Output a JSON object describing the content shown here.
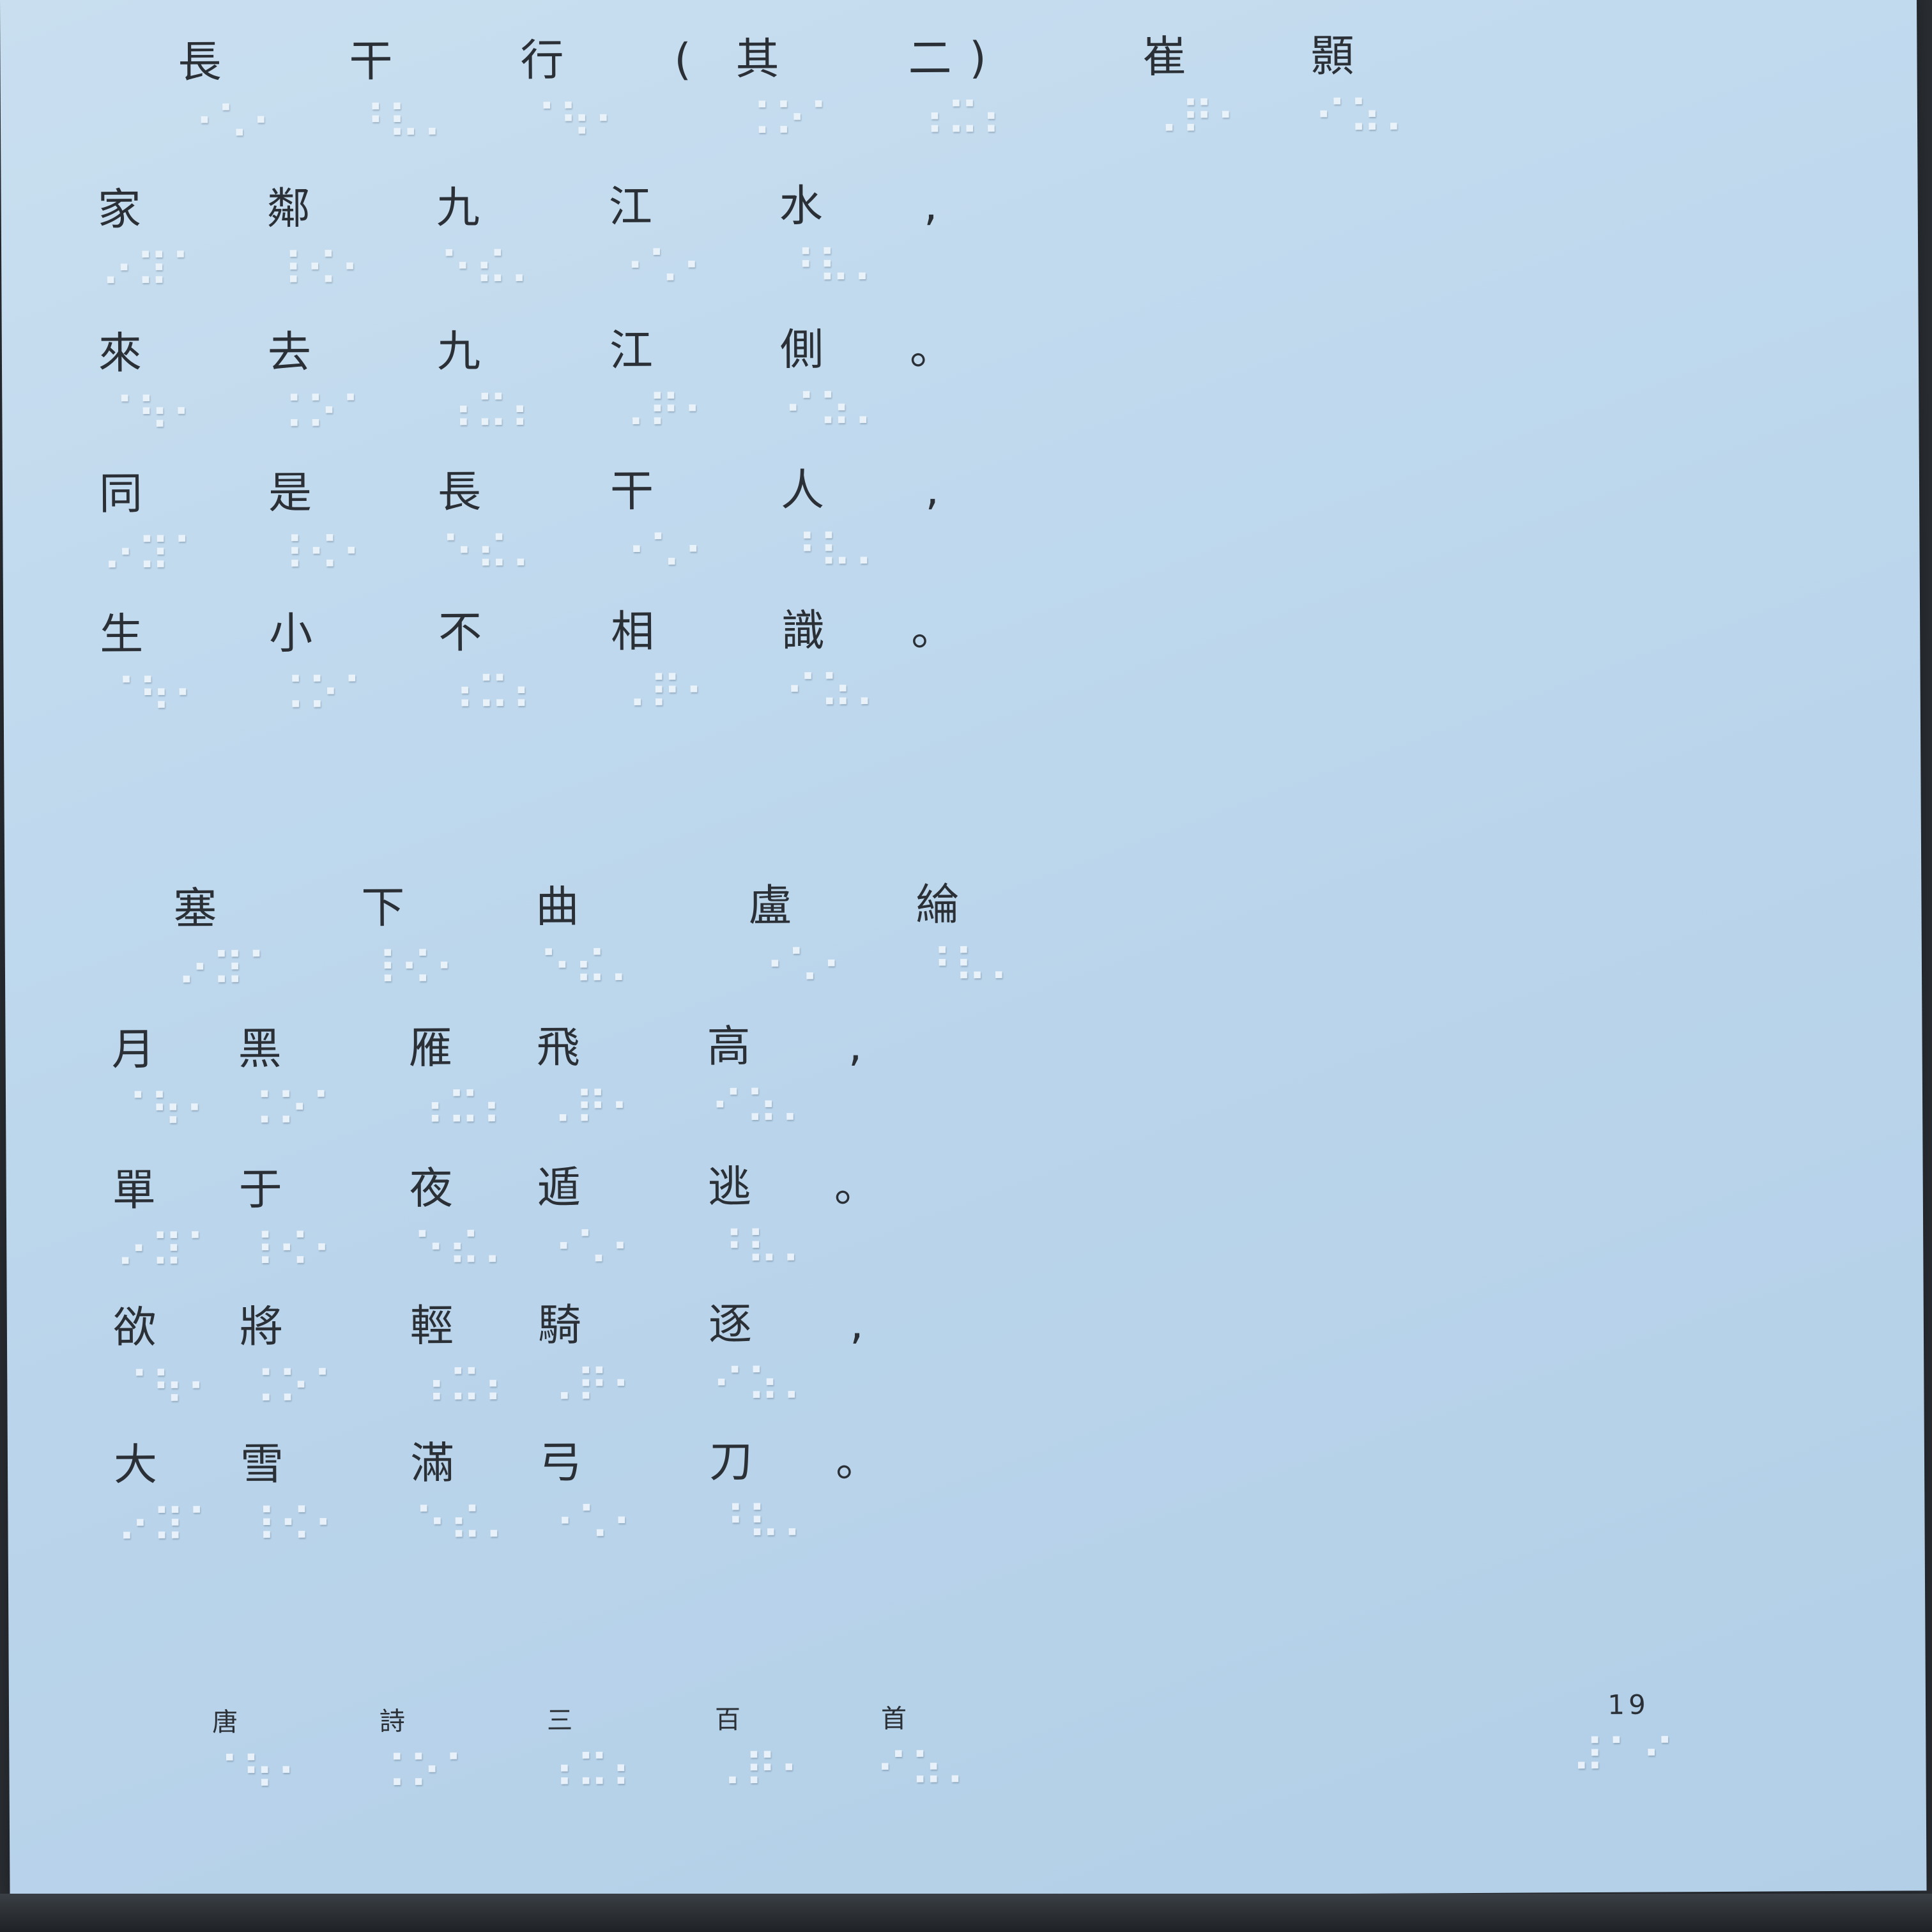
{
  "poem1": {
    "title_chars": [
      "長",
      "干",
      "行",
      "(",
      "其",
      "二",
      ")",
      "崔",
      "顥"
    ],
    "lines": [
      [
        "家",
        "鄰",
        "九",
        "江",
        "水",
        ","
      ],
      [
        "來",
        "去",
        "九",
        "江",
        "側",
        "。"
      ],
      [
        "同",
        "是",
        "長",
        "干",
        "人",
        ","
      ],
      [
        "生",
        "小",
        "不",
        "相",
        "識",
        "。"
      ]
    ]
  },
  "poem2": {
    "title_chars": [
      "塞",
      "下",
      "曲",
      "盧",
      "綸"
    ],
    "lines": [
      [
        "月",
        "黑",
        "雁",
        "飛",
        "高",
        ","
      ],
      [
        "單",
        "于",
        "夜",
        "遁",
        "逃",
        "。"
      ],
      [
        "欲",
        "將",
        "輕",
        "騎",
        "逐",
        ","
      ],
      [
        "大",
        "雪",
        "滿",
        "弓",
        "刀",
        "。"
      ]
    ]
  },
  "footer": {
    "book_title_chars": [
      "唐",
      "詩",
      "三",
      "百",
      "首"
    ],
    "page_number": "19"
  },
  "braille_icon": "braille-dots"
}
